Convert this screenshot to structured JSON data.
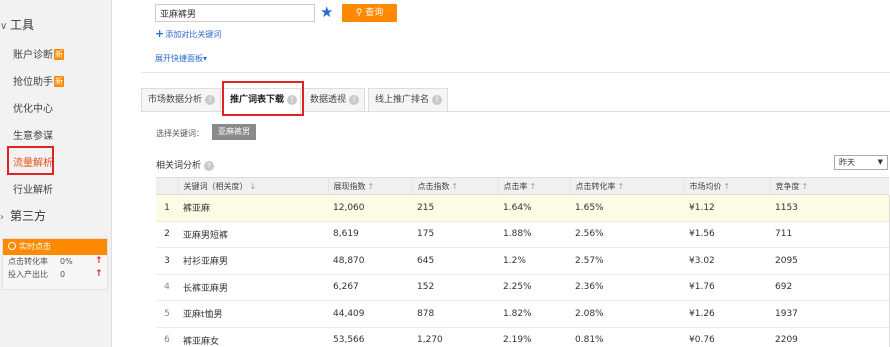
{
  "sidebar": {
    "tools_group": "工具",
    "items": [
      {
        "label": "账户诊断",
        "badge": "新"
      },
      {
        "label": "抢位助手",
        "badge": "新"
      },
      {
        "label": "优化中心",
        "badge": ""
      },
      {
        "label": "生意参谋",
        "badge": ""
      },
      {
        "label": "流量解析",
        "badge": ""
      },
      {
        "label": "行业解析",
        "badge": ""
      }
    ],
    "third_party_group": "第三方",
    "realtime": {
      "title": "实时点击",
      "rows": [
        {
          "label": "点击转化率",
          "value": "0%"
        },
        {
          "label": "投入产出比",
          "value": "0"
        }
      ]
    }
  },
  "search": {
    "value": "亚麻裤男",
    "query_label": "查询",
    "add_compare_label": "添加对比关键词",
    "expand_label": "展开快捷面板"
  },
  "tabs": [
    {
      "label": "市场数据分析"
    },
    {
      "label": "推广词表下载"
    },
    {
      "label": "数据透视"
    },
    {
      "label": "线上推广排名"
    }
  ],
  "selected_keyword": {
    "label": "选择关键词：",
    "tag": "亚麻裤男"
  },
  "related": {
    "title": "相关词分析",
    "period": "昨天"
  },
  "table": {
    "headers": [
      "关键词（相关度）",
      "展现指数",
      "点击指数",
      "点击率",
      "点击转化率",
      "市场均价",
      "竞争度"
    ],
    "rows": [
      {
        "rank": "1",
        "keyword": "裤亚麻",
        "impressions": "12,060",
        "clicks": "215",
        "ctr": "1.64%",
        "cvr": "1.65%",
        "price": "¥1.12",
        "competition": "1153"
      },
      {
        "rank": "2",
        "keyword": "亚麻男短裤",
        "impressions": "8,619",
        "clicks": "175",
        "ctr": "1.88%",
        "cvr": "2.56%",
        "price": "¥1.56",
        "competition": "711"
      },
      {
        "rank": "3",
        "keyword": "衬衫亚麻男",
        "impressions": "48,870",
        "clicks": "645",
        "ctr": "1.2%",
        "cvr": "2.57%",
        "price": "¥3.02",
        "competition": "2095"
      },
      {
        "rank": "4",
        "keyword": "长裤亚麻男",
        "impressions": "6,267",
        "clicks": "152",
        "ctr": "2.25%",
        "cvr": "2.36%",
        "price": "¥1.76",
        "competition": "692"
      },
      {
        "rank": "5",
        "keyword": "亚麻t恤男",
        "impressions": "44,409",
        "clicks": "878",
        "ctr": "1.82%",
        "cvr": "2.08%",
        "price": "¥1.26",
        "competition": "1937"
      },
      {
        "rank": "6",
        "keyword": "裤亚麻女",
        "impressions": "53,566",
        "clicks": "1,270",
        "ctr": "2.19%",
        "cvr": "0.81%",
        "price": "¥0.76",
        "competition": "2209"
      }
    ]
  }
}
